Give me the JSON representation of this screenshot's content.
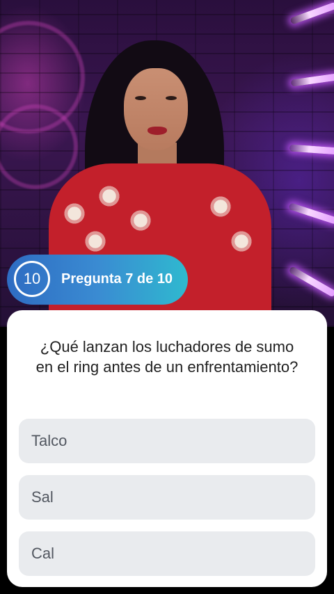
{
  "timer": {
    "seconds": "10"
  },
  "question": {
    "counter": "Pregunta 7 de 10",
    "text": "¿Qué lanzan los luchadores de sumo en el ring antes de un enfrentamiento?"
  },
  "options": [
    {
      "label": "Talco"
    },
    {
      "label": "Sal"
    },
    {
      "label": "Cal"
    }
  ],
  "colors": {
    "pill_start": "#2e6cc2",
    "pill_end": "#2fb9cf",
    "option_bg": "#e9ebee",
    "option_text": "#525760",
    "question_text": "#1f1f1f"
  }
}
